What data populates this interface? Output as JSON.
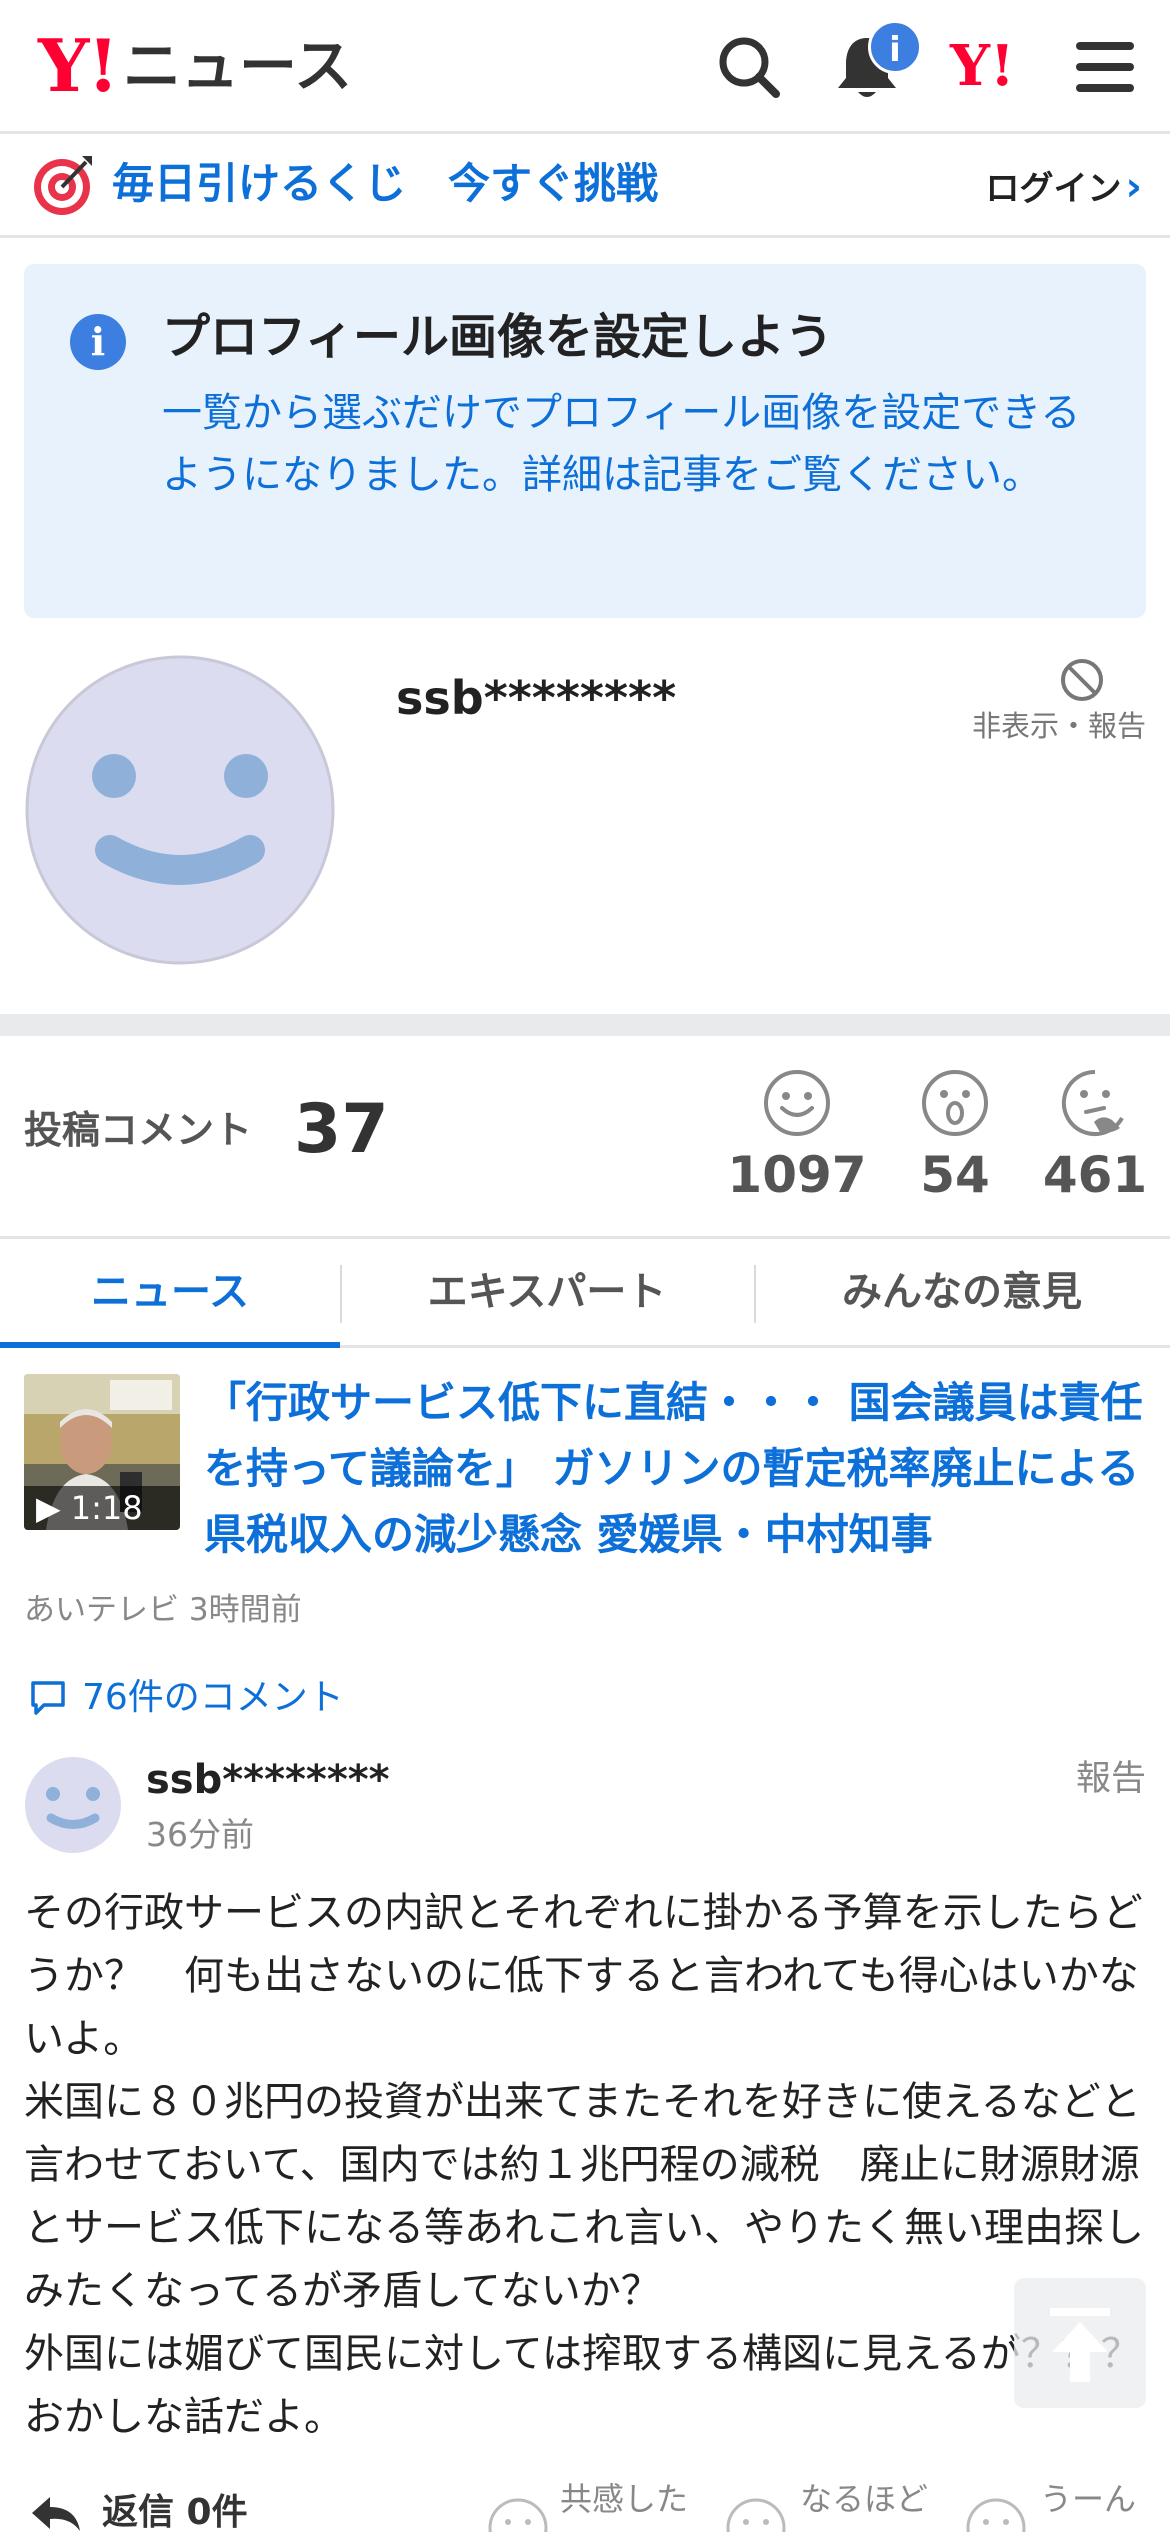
{
  "header": {
    "logo_mark": "Y!",
    "logo_text": "ニュース",
    "notification_badge": "i",
    "yahoo_mark": "Y!"
  },
  "lottery": {
    "text": "毎日引けるくじ　今すぐ挑戦",
    "login_label": "ログイン"
  },
  "info": {
    "icon": "i",
    "title": "プロフィール画像を設定しよう",
    "body": "一覧から選ぶだけでプロフィール画像を設定できるようになりました。詳細は記事をご覧ください。"
  },
  "profile": {
    "username": "ssb********",
    "hide_report_label": "非表示・報告"
  },
  "stats": {
    "label": "投稿コメント",
    "count": "37",
    "reactions": [
      {
        "icon": "smile-face-icon",
        "count": "1097"
      },
      {
        "icon": "surprised-face-icon",
        "count": "54"
      },
      {
        "icon": "thinking-face-icon",
        "count": "461"
      }
    ]
  },
  "tabs": [
    {
      "label": "ニュース",
      "active": true
    },
    {
      "label": "エキスパート",
      "active": false
    },
    {
      "label": "みんなの意見",
      "active": false
    }
  ],
  "article": {
    "video_time": "▶ 1:18",
    "title": "「行政サービス低下に直結・・・ 国会議員は責任を持って議論を」 ガソリンの暫定税率廃止による県税収入の減少懸念 愛媛県・中村知事",
    "meta": "あいテレビ 3時間前",
    "comment_count_label": "76件のコメント"
  },
  "comment": {
    "username": "ssb********",
    "time": "36分前",
    "report_label": "報告",
    "body": "その行政サービスの内訳とそれぞれに掛かる予算を示したらどうか？　何も出さないのに低下すると言われても得心はいかないよ。\n米国に８０兆円の投資が出来てまたそれを好きに使えるなどと言わせておいて、国内では約１兆円程の減税　廃止に財源財源とサービス低下になる等あれこれ言い、やりたく無い理由探しみたくなってるが矛盾してないか？\n外国には媚びて国民に対しては搾取する構図に見えるが？？？おかしな話だよ。",
    "reply_label": "返信 0件",
    "reactions": [
      "共感した",
      "なるほど",
      "うーん"
    ]
  },
  "colors": {
    "brand_red": "#ff0033",
    "link_blue": "#0d6fd8",
    "info_bg": "#e8f2fd",
    "avatar_bg": "#dcdcf0",
    "avatar_face": "#8fb0d9"
  }
}
